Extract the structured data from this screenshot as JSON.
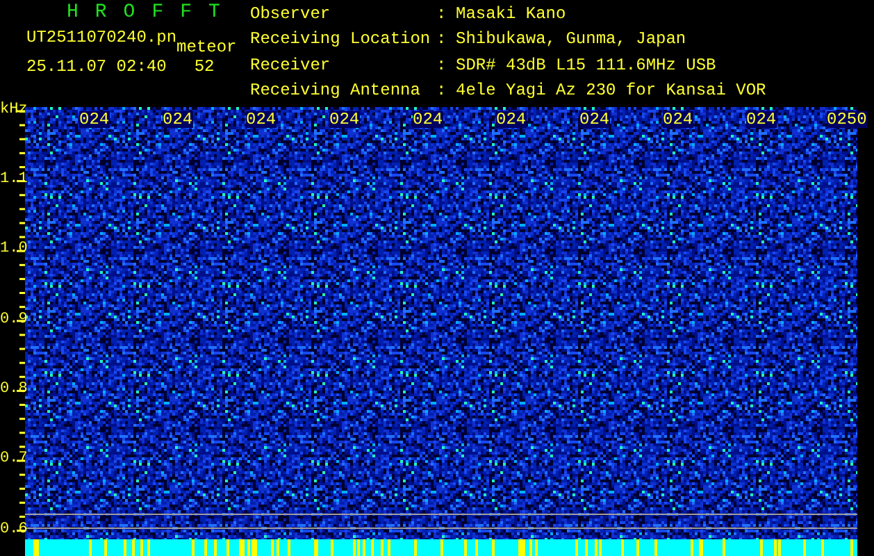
{
  "header": {
    "program_title": "HROFFT",
    "file_name": "UT2511070240.pn",
    "tag": "meteor",
    "timestamp": "25.11.07 02:40",
    "count": "52"
  },
  "info": [
    {
      "label": "Observer",
      "separator": ":",
      "value": "Masaki Kano"
    },
    {
      "label": "Receiving Location",
      "separator": ":",
      "value": "Shibukawa, Gunma, Japan"
    },
    {
      "label": "Receiver",
      "separator": ":",
      "value": "SDR# 43dB L15 111.6MHz USB"
    },
    {
      "label": "Receiving Antenna",
      "separator": ":",
      "value": "4ele Yagi Az 230 for Kansai VOR"
    }
  ],
  "spectrogram": {
    "unit": "kHz",
    "y_ticks": [
      "1.1",
      "1.0",
      "0.9",
      "0.8",
      "0.7",
      "0.6"
    ],
    "time_labels": [
      "024",
      "024",
      "024",
      "024",
      "024",
      "024",
      "024",
      "024",
      "024",
      "0250"
    ]
  }
}
